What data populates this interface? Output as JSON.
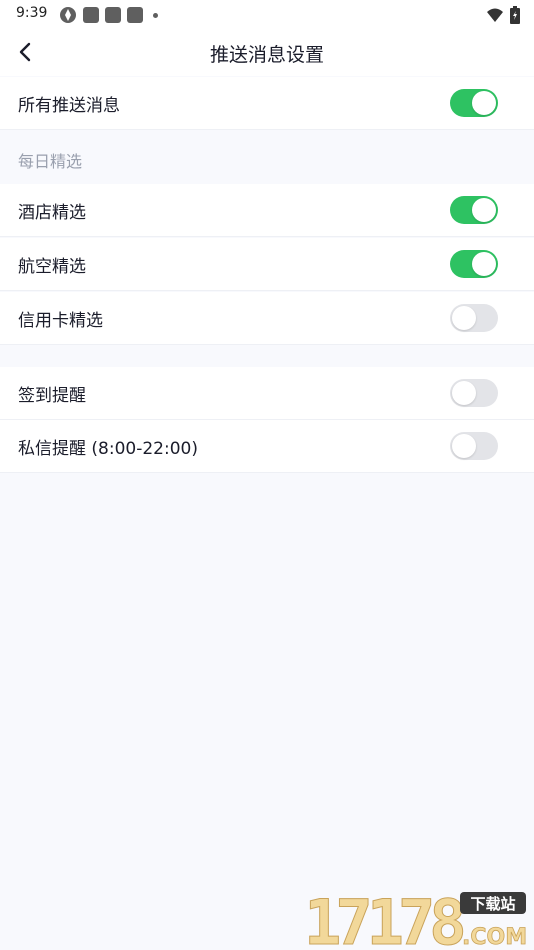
{
  "status_bar": {
    "time": "9:39"
  },
  "header": {
    "title": "推送消息设置"
  },
  "rows": {
    "all": {
      "label": "所有推送消息",
      "on": true
    },
    "section_daily": "每日精选",
    "hotel": {
      "label": "酒店精选",
      "on": true
    },
    "flight": {
      "label": "航空精选",
      "on": true
    },
    "credit": {
      "label": "信用卡精选",
      "on": false
    },
    "checkin": {
      "label": "签到提醒",
      "on": false
    },
    "message": {
      "label": "私信提醒 (8:00-22:00)",
      "on": false
    }
  },
  "colors": {
    "toggle_on": "#2ec262",
    "toggle_off": "#e3e4e8",
    "background": "#f8f9fd"
  },
  "watermark": {
    "number": "17178",
    "badge": "下载站",
    "suffix": ".COM"
  }
}
